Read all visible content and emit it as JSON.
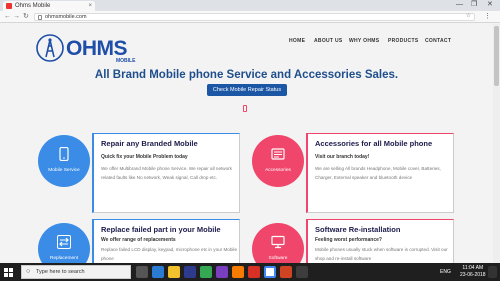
{
  "browser": {
    "tab_title": "Ohms Mobile",
    "tab_close": "×",
    "url": "ohmsmobile.com",
    "win_min": "—",
    "win_max": "❐",
    "win_close": "✕",
    "back": "←",
    "forward": "→",
    "reload": "↻",
    "star": "☆",
    "menu": "⋮"
  },
  "site": {
    "logo_text": "OHMS",
    "logo_sub": "MOBILE",
    "nav": [
      "HOME",
      "ABOUT US",
      "WHY OHMS",
      "PRODUCTS",
      "CONTACT"
    ],
    "headline": "All Brand Mobile phone Service and Accessories Sales.",
    "cta": "Check Mobile Repair Status"
  },
  "services": [
    {
      "circle_label": "Mobile Service",
      "title": "Repair any Branded Mobile",
      "subtitle": "Quick fix your Mobile Problem today",
      "body": "We offer Multibrand Mobile phone Service. We repair all network related faults like No network, Weak signal, Call drop etc."
    },
    {
      "circle_label": "Accessories",
      "title": "Accessories for all Mobile phone",
      "subtitle": "Visit our branch today!",
      "body": "We are selling All brands Headphone, Mobile cover, Batteries, Charger, External speaker and bluetooth device"
    },
    {
      "circle_label": "Replacement",
      "title": "Replace failed part in your Mobile",
      "subtitle": "We offer range of replacements",
      "body": "Replace failed LCD display, keypad, microphone etc in your Mobile phone"
    },
    {
      "circle_label": "Software",
      "title": "Software Re-installation",
      "subtitle": "Feeling worst performance?",
      "body": "Mobile phones usually stuck when software is corrupted. Visit our shop and re-install software"
    }
  ],
  "taskbar": {
    "search_placeholder": "Type here to search",
    "lang": "ENG",
    "time": "11:04 AM",
    "date": "23-06-2018"
  },
  "colors": {
    "brand_blue": "#1e4ea8",
    "service_blue": "#3a8ce6",
    "accessory_pink": "#f0466b",
    "cta_blue": "#1c57a5"
  }
}
